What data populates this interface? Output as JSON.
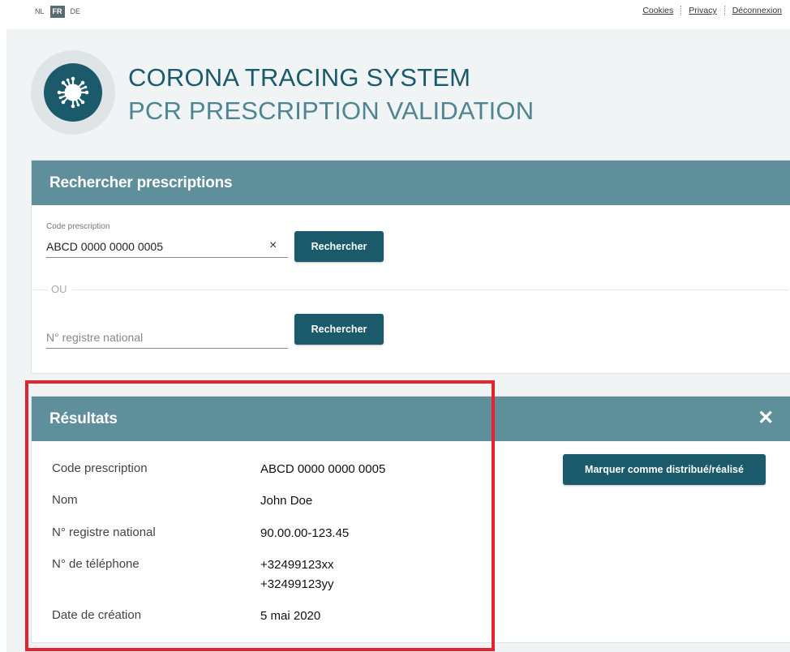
{
  "header": {
    "languages": [
      {
        "code": "NL",
        "active": false
      },
      {
        "code": "FR",
        "active": true
      },
      {
        "code": "DE",
        "active": false
      }
    ],
    "links": [
      "Cookies",
      "Privacy",
      "Déconnexion"
    ]
  },
  "brand": {
    "title": "CORONA TRACING SYSTEM",
    "subtitle": "PCR PRESCRIPTION VALIDATION",
    "logo_icon": "virus-icon"
  },
  "search": {
    "title": "Rechercher prescriptions",
    "code_label": "Code prescription",
    "code_value": "ABCD 0000 0000 0005",
    "clear_symbol": "×",
    "search_button": "Rechercher",
    "or_label": "OU",
    "nrn_placeholder": "N° registre national",
    "nrn_value": "",
    "search_button_2": "Rechercher"
  },
  "results": {
    "title": "Résultats",
    "close_symbol": "✕",
    "action_button": "Marquer comme distribué/réalisé",
    "rows": [
      {
        "label": "Code prescription",
        "value": "ABCD 0000 0000 0005"
      },
      {
        "label": "Nom",
        "value": "John Doe"
      },
      {
        "label": "N° registre national",
        "value": "90.00.00-123.45"
      },
      {
        "label": "N° de téléphone",
        "value": "+32499123xx",
        "value2": "+32499123yy"
      },
      {
        "label": "Date de création",
        "value": "5 mai 2020"
      }
    ]
  },
  "colors": {
    "primary": "#1b5a6b",
    "panel_header": "#5f8f9b",
    "highlight": "#e52330",
    "background": "#f1f4f5"
  }
}
